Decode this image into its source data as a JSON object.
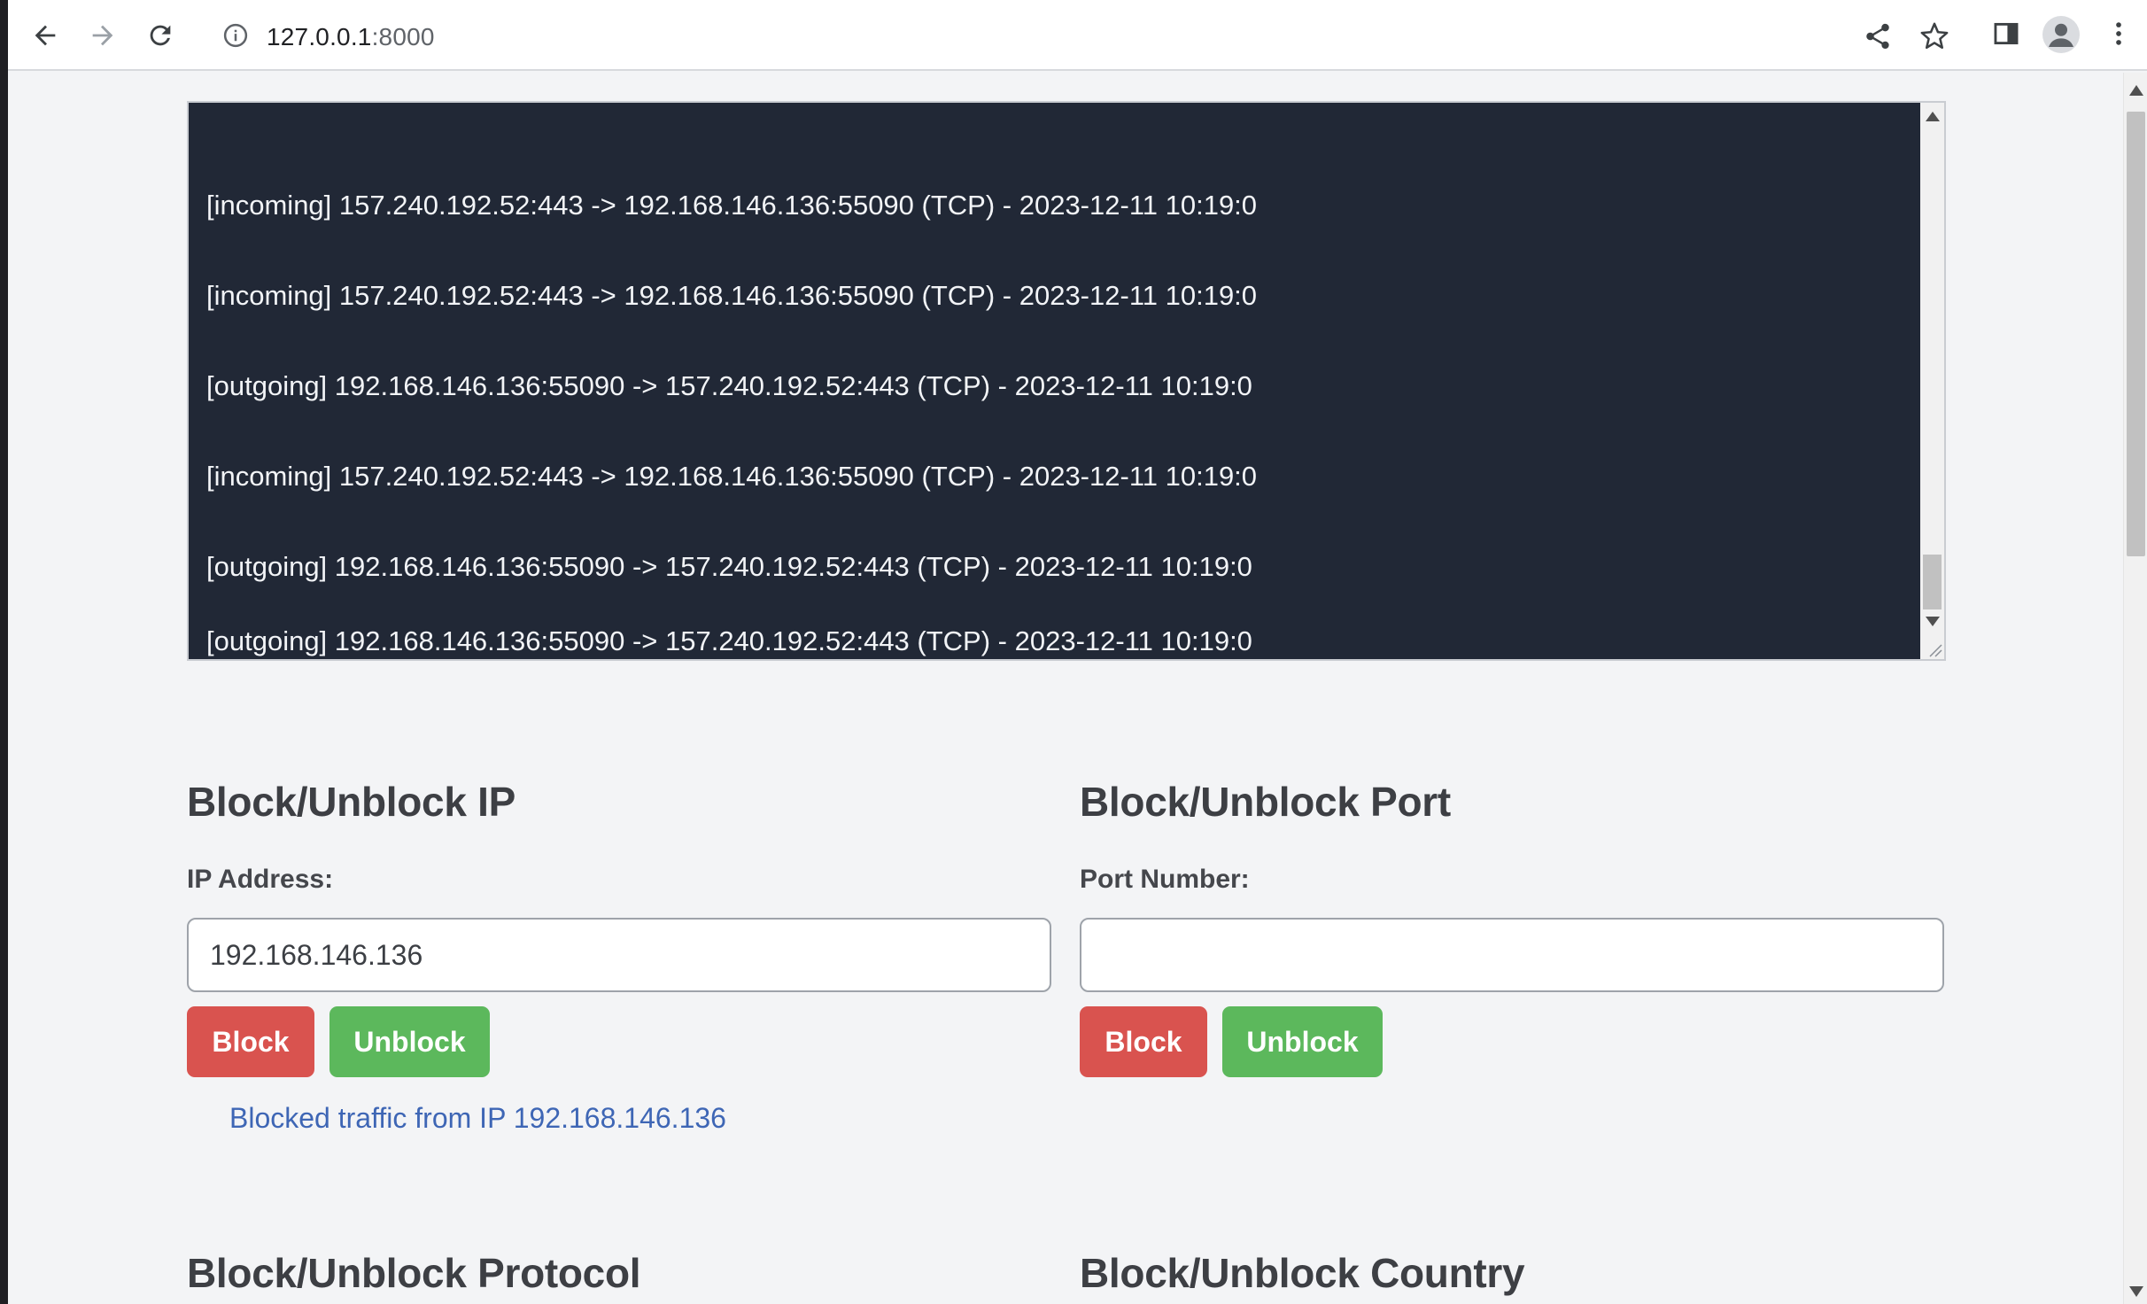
{
  "browser": {
    "url_host": "127.0.0.1",
    "url_port": ":8000"
  },
  "log": {
    "lines": [
      "[incoming] 157.240.192.52:443 -> 192.168.146.136:55090 (TCP) - 2023-12-11 10:19:0",
      "[incoming] 157.240.192.52:443 -> 192.168.146.136:55090 (TCP) - 2023-12-11 10:19:0",
      "[outgoing] 192.168.146.136:55090 -> 157.240.192.52:443 (TCP) - 2023-12-11 10:19:0",
      "[incoming] 157.240.192.52:443 -> 192.168.146.136:55090 (TCP) - 2023-12-11 10:19:0",
      "[outgoing] 192.168.146.136:55090 -> 157.240.192.52:443 (TCP) - 2023-12-11 10:19:0",
      "[outgoing] 192.168.146.136:55090 -> 157.240.192.52:443 (TCP) - 2023-12-11 10:19:0"
    ]
  },
  "ip_section": {
    "title": "Block/Unblock IP",
    "label": "IP Address:",
    "value": "192.168.146.136",
    "block_label": "Block",
    "unblock_label": "Unblock",
    "status": "Blocked traffic from IP 192.168.146.136"
  },
  "port_section": {
    "title": "Block/Unblock Port",
    "label": "Port Number:",
    "value": "",
    "block_label": "Block",
    "unblock_label": "Unblock"
  },
  "protocol_section": {
    "title": "Block/Unblock Protocol"
  },
  "country_section": {
    "title": "Block/Unblock Country"
  },
  "colors": {
    "block": "#d9534f",
    "unblock": "#5cb85c",
    "log_bg": "#212836",
    "status": "#3e66b5"
  }
}
